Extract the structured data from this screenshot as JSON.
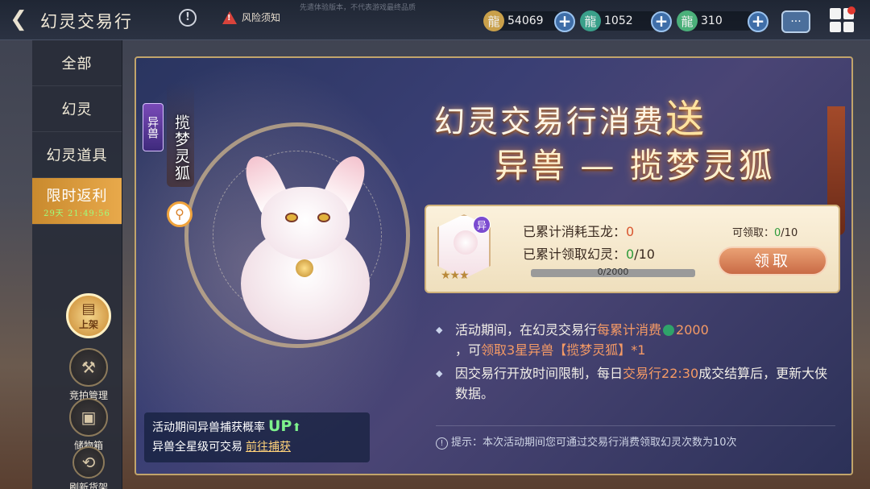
{
  "header": {
    "title": "幻灵交易行",
    "risk_label": "风险须知",
    "disclaimer": "先遣体验版本，不代表游戏最终品质",
    "currencies": [
      {
        "icon": "gold-dragon-icon",
        "value": "54069"
      },
      {
        "icon": "jade-dragon-icon",
        "value": "1052"
      },
      {
        "icon": "green-dragon-icon",
        "value": "310"
      }
    ]
  },
  "sidebar": {
    "items": [
      {
        "label": "全部"
      },
      {
        "label": "幻灵"
      },
      {
        "label": "幻灵道具"
      },
      {
        "label": "限时返利",
        "countdown": "29天 21:49:56"
      }
    ]
  },
  "actions": {
    "shelf": "上架",
    "auction": "竞拍管理",
    "storage": "储物箱",
    "refresh": "刷新货架"
  },
  "hero": {
    "badge": "异兽",
    "name": "揽梦灵狐",
    "promo_line1": "活动期间异兽捕获概率",
    "promo_up": "UP",
    "promo_line2": "异兽全星级可交易",
    "promo_link": "前往捕获"
  },
  "banner": {
    "line1_a": "幻灵交易行消费",
    "line1_b": "送",
    "line2": "异兽 — 揽梦灵狐"
  },
  "reward": {
    "pet_tag": "异",
    "stars": "★★★",
    "stat1_label": "已累计消耗玉龙：",
    "stat1_value": "0",
    "stat2_label": "已累计领取幻灵：",
    "stat2_value": "0",
    "stat2_total": "/10",
    "progress_text": "0/2000",
    "progress_ratio": 0,
    "claimable_label": "可领取：",
    "claimable_value": "0",
    "claimable_total": "/10",
    "claim_button": "领取"
  },
  "rules": {
    "r1_a": "活动期间，在幻灵交易行",
    "r1_b": "每累计消费",
    "r1_c": "2000",
    "r1_d": "，可",
    "r1_e": "领取3星异兽【揽梦灵狐】",
    "r1_f": "*1",
    "r2_a": "因交易行开放时间限制，每日",
    "r2_b": "交易行22:30",
    "r2_c": "成交结算后，更新大侠数据。"
  },
  "tip": "提示：本次活动期间您可通过交易行消费领取幻灵次数为10次"
}
